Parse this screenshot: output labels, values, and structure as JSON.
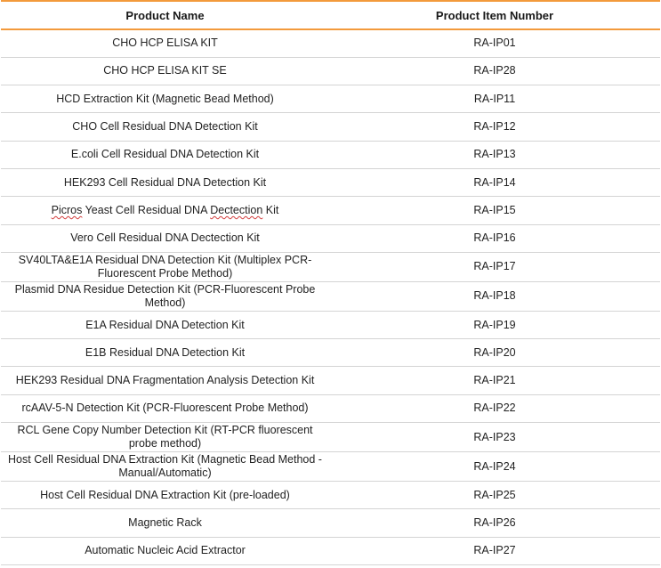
{
  "table": {
    "headers": {
      "name": "Product Name",
      "number": "Product Item Number"
    },
    "rows": [
      {
        "name": "CHO HCP ELISA KIT",
        "number": "RA-IP01"
      },
      {
        "name": "CHO HCP ELISA KIT SE",
        "number": "RA-IP28"
      },
      {
        "name": "HCD Extraction Kit (Magnetic Bead Method)",
        "number": "RA-IP11"
      },
      {
        "name": "CHO Cell Residual DNA Detection Kit",
        "number": "RA-IP12"
      },
      {
        "name": "E.coli Cell Residual DNA Detection Kit",
        "number": "RA-IP13"
      },
      {
        "name": "HEK293 Cell Residual DNA Detection Kit",
        "number": "RA-IP14"
      },
      {
        "name_parts": [
          "Picros",
          " Yeast Cell Residual DNA ",
          "Dectection",
          " Kit"
        ],
        "number": "RA-IP15"
      },
      {
        "name": "Vero Cell Residual DNA Dectection Kit",
        "number": "RA-IP16"
      },
      {
        "name": "SV40LTA&E1A Residual DNA Detection Kit (Multiplex PCR-Fluorescent Probe Method)",
        "number": "RA-IP17"
      },
      {
        "name": "Plasmid DNA Residue Detection Kit (PCR-Fluorescent Probe Method)",
        "number": "RA-IP18"
      },
      {
        "name": "E1A Residual DNA Detection Kit",
        "number": "RA-IP19"
      },
      {
        "name": "E1B Residual DNA Detection Kit",
        "number": "RA-IP20"
      },
      {
        "name": "HEK293 Residual DNA Fragmentation Analysis Detection Kit",
        "number": "RA-IP21"
      },
      {
        "name": "rcAAV-5-N Detection Kit (PCR-Fluorescent Probe Method)",
        "number": "RA-IP22"
      },
      {
        "name": "RCL Gene Copy Number Detection Kit (RT-PCR fluorescent probe method)",
        "number": "RA-IP23"
      },
      {
        "name": "Host Cell Residual DNA Extraction Kit (Magnetic Bead Method - Manual/Automatic)",
        "number": "RA-IP24"
      },
      {
        "name": "Host Cell Residual DNA Extraction Kit (pre-loaded)",
        "number": "RA-IP25"
      },
      {
        "name": "Magnetic Rack",
        "number": "RA-IP26"
      },
      {
        "name": "Automatic Nucleic Acid Extractor",
        "number": "RA-IP27"
      }
    ]
  },
  "colors": {
    "accent": "#f39a3c",
    "row_divider": "#d4d4d4",
    "spellcheck_underline": "#d23c3c"
  }
}
